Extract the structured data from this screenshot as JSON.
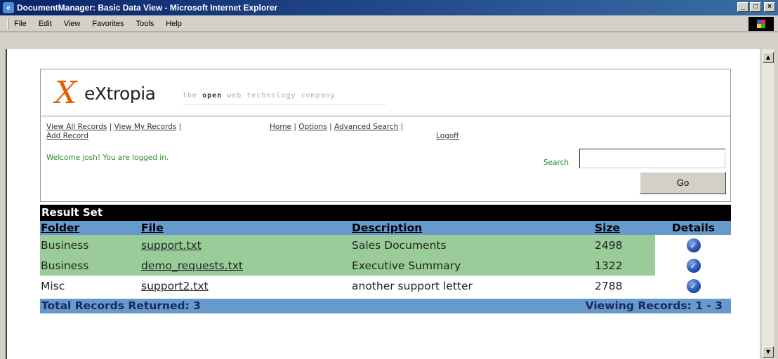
{
  "window": {
    "title": "DocumentManager: Basic Data View - Microsoft Internet Explorer",
    "icon": "ie-page-icon"
  },
  "menu": [
    "File",
    "Edit",
    "View",
    "Favorites",
    "Tools",
    "Help"
  ],
  "logo": {
    "mark": "X",
    "name": "eXtropia",
    "tagline_pre": "the ",
    "tagline_bold": "open",
    "tagline_post": " web technology company",
    "brand_color": "#e65c00"
  },
  "nav": {
    "view_all": "View All Records",
    "view_my": "View My Records",
    "add_record": "Add Record",
    "home": "Home",
    "options": "Options",
    "advanced_search": "Advanced Search",
    "logoff": "Logoff",
    "separator": "|"
  },
  "welcome": "Welcome josh! You are logged in.",
  "search": {
    "label": "Search",
    "value": "",
    "button": "Go"
  },
  "results": {
    "title": "Result Set",
    "columns": [
      "Folder",
      "File",
      "Description",
      "Size",
      "Details"
    ],
    "rows": [
      {
        "folder": "Business",
        "file": "support.txt",
        "description": "Sales Documents",
        "size": "2498",
        "highlighted": true
      },
      {
        "folder": "Business",
        "file": "demo_requests.txt",
        "description": "Executive Summary",
        "size": "1322",
        "highlighted": true
      },
      {
        "folder": "Misc",
        "file": "support2.txt",
        "description": "another support letter",
        "size": "2788",
        "highlighted": false
      }
    ],
    "total": "Total Records Returned: 3",
    "viewing": "Viewing Records: 1 - 3"
  },
  "colors": {
    "header_blue": "#6699cc",
    "row_green": "#99cc99",
    "welcome_green": "#2c8a2c"
  }
}
